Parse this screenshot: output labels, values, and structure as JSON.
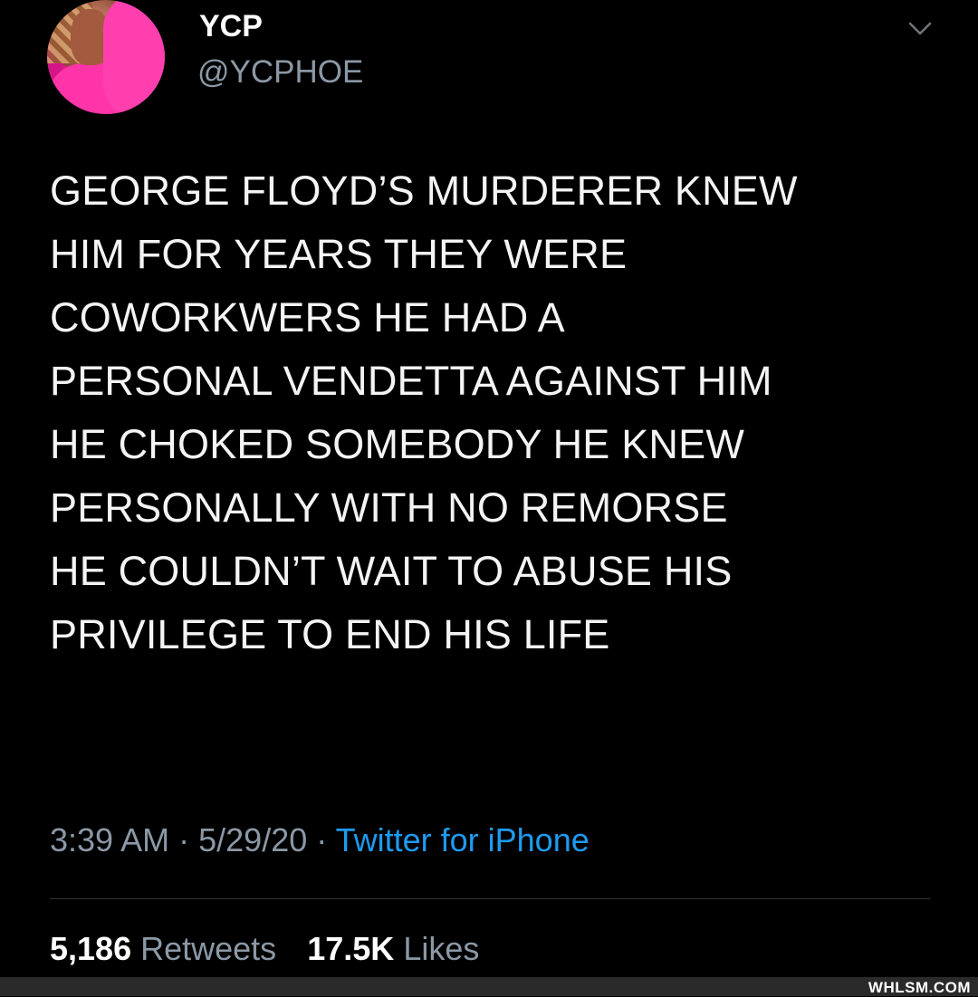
{
  "author": {
    "display_name": "YCP",
    "handle": "@YCPHOE",
    "avatar_icon": "profile-photo-avatar"
  },
  "menu": {
    "icon": "chevron-down-icon"
  },
  "tweet": {
    "lines": [
      "GEORGE FLOYD’S MURDERER KNEW",
      "HIM FOR YEARS THEY WERE",
      "COWORKWERS HE HAD A",
      "PERSONAL VENDETTA AGAINST HIM",
      "HE CHOKED SOMEBODY HE KNEW",
      "PERSONALLY WITH NO REMORSE",
      "HE COULDN’T WAIT TO ABUSE HIS",
      "PRIVILEGE TO END HIS LIFE"
    ],
    "time": "3:39 AM",
    "separator": "·",
    "date": "5/29/20",
    "source": "Twitter for iPhone"
  },
  "stats": {
    "retweets_count": "5,186",
    "retweets_label": "Retweets",
    "likes_count": "17.5K",
    "likes_label": "Likes"
  },
  "watermark": {
    "text": "WHLSM.COM"
  },
  "colors": {
    "background": "#000000",
    "text": "#f4f4f4",
    "muted": "#8b98a5",
    "link": "#1d9bf0"
  }
}
